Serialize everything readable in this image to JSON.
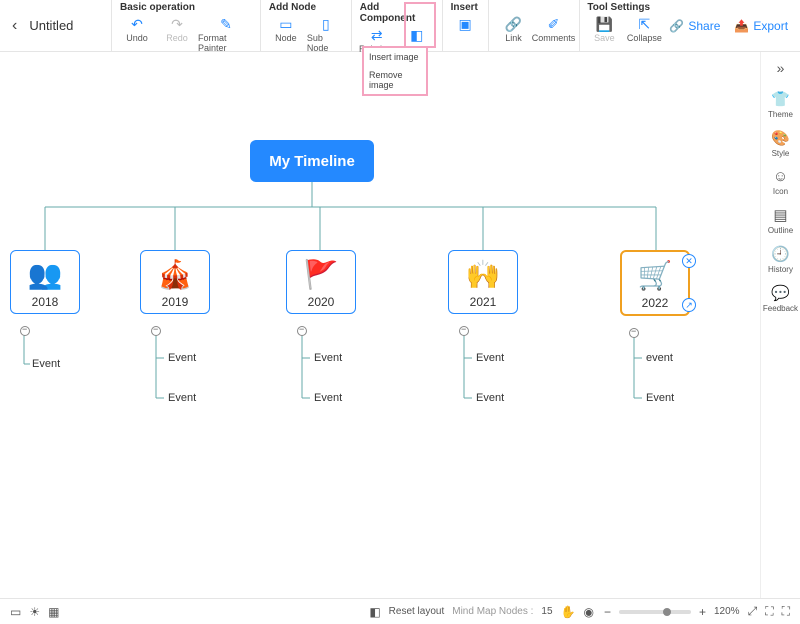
{
  "doc": {
    "title": "Untitled"
  },
  "toolbar_groups": {
    "basic": {
      "title": "Basic operation",
      "undo": "Undo",
      "redo": "Redo",
      "format_painter": "Format Painter"
    },
    "addnode": {
      "title": "Add Node",
      "node": "Node",
      "subnode": "Sub Node"
    },
    "addcomp": {
      "title": "Add Component",
      "relation": "Relation."
    },
    "insert": {
      "title": "Insert",
      "image": ""
    },
    "middle": {
      "link": "Link",
      "comments": "Comments"
    },
    "toolset": {
      "title": "Tool Settings",
      "save": "Save",
      "collapse": "Collapse"
    }
  },
  "toolbar_right": {
    "share": "Share",
    "export": "Export"
  },
  "dropdown": {
    "insert_image": "Insert image",
    "remove_image": "Remove image"
  },
  "sidepanel": {
    "theme": "Theme",
    "style": "Style",
    "icon": "Icon",
    "outline": "Outline",
    "history": "History",
    "feedback": "Feedback"
  },
  "mindmap": {
    "root": "My Timeline",
    "years": [
      {
        "label": "2018",
        "events": [
          "Event"
        ]
      },
      {
        "label": "2019",
        "events": [
          "Event",
          "Event"
        ]
      },
      {
        "label": "2020",
        "events": [
          "Event",
          "Event"
        ]
      },
      {
        "label": "2021",
        "events": [
          "Event",
          "Event"
        ]
      },
      {
        "label": "2022",
        "events": [
          "event",
          "Event"
        ]
      }
    ]
  },
  "bottombar": {
    "reset_layout": "Reset layout",
    "nodes_label": "Mind Map Nodes :",
    "nodes_count": "15",
    "zoom_pct": "120%"
  },
  "colors": {
    "accent": "#2489ff",
    "highlight": "#f4a3bf",
    "selected": "#f0a020"
  }
}
